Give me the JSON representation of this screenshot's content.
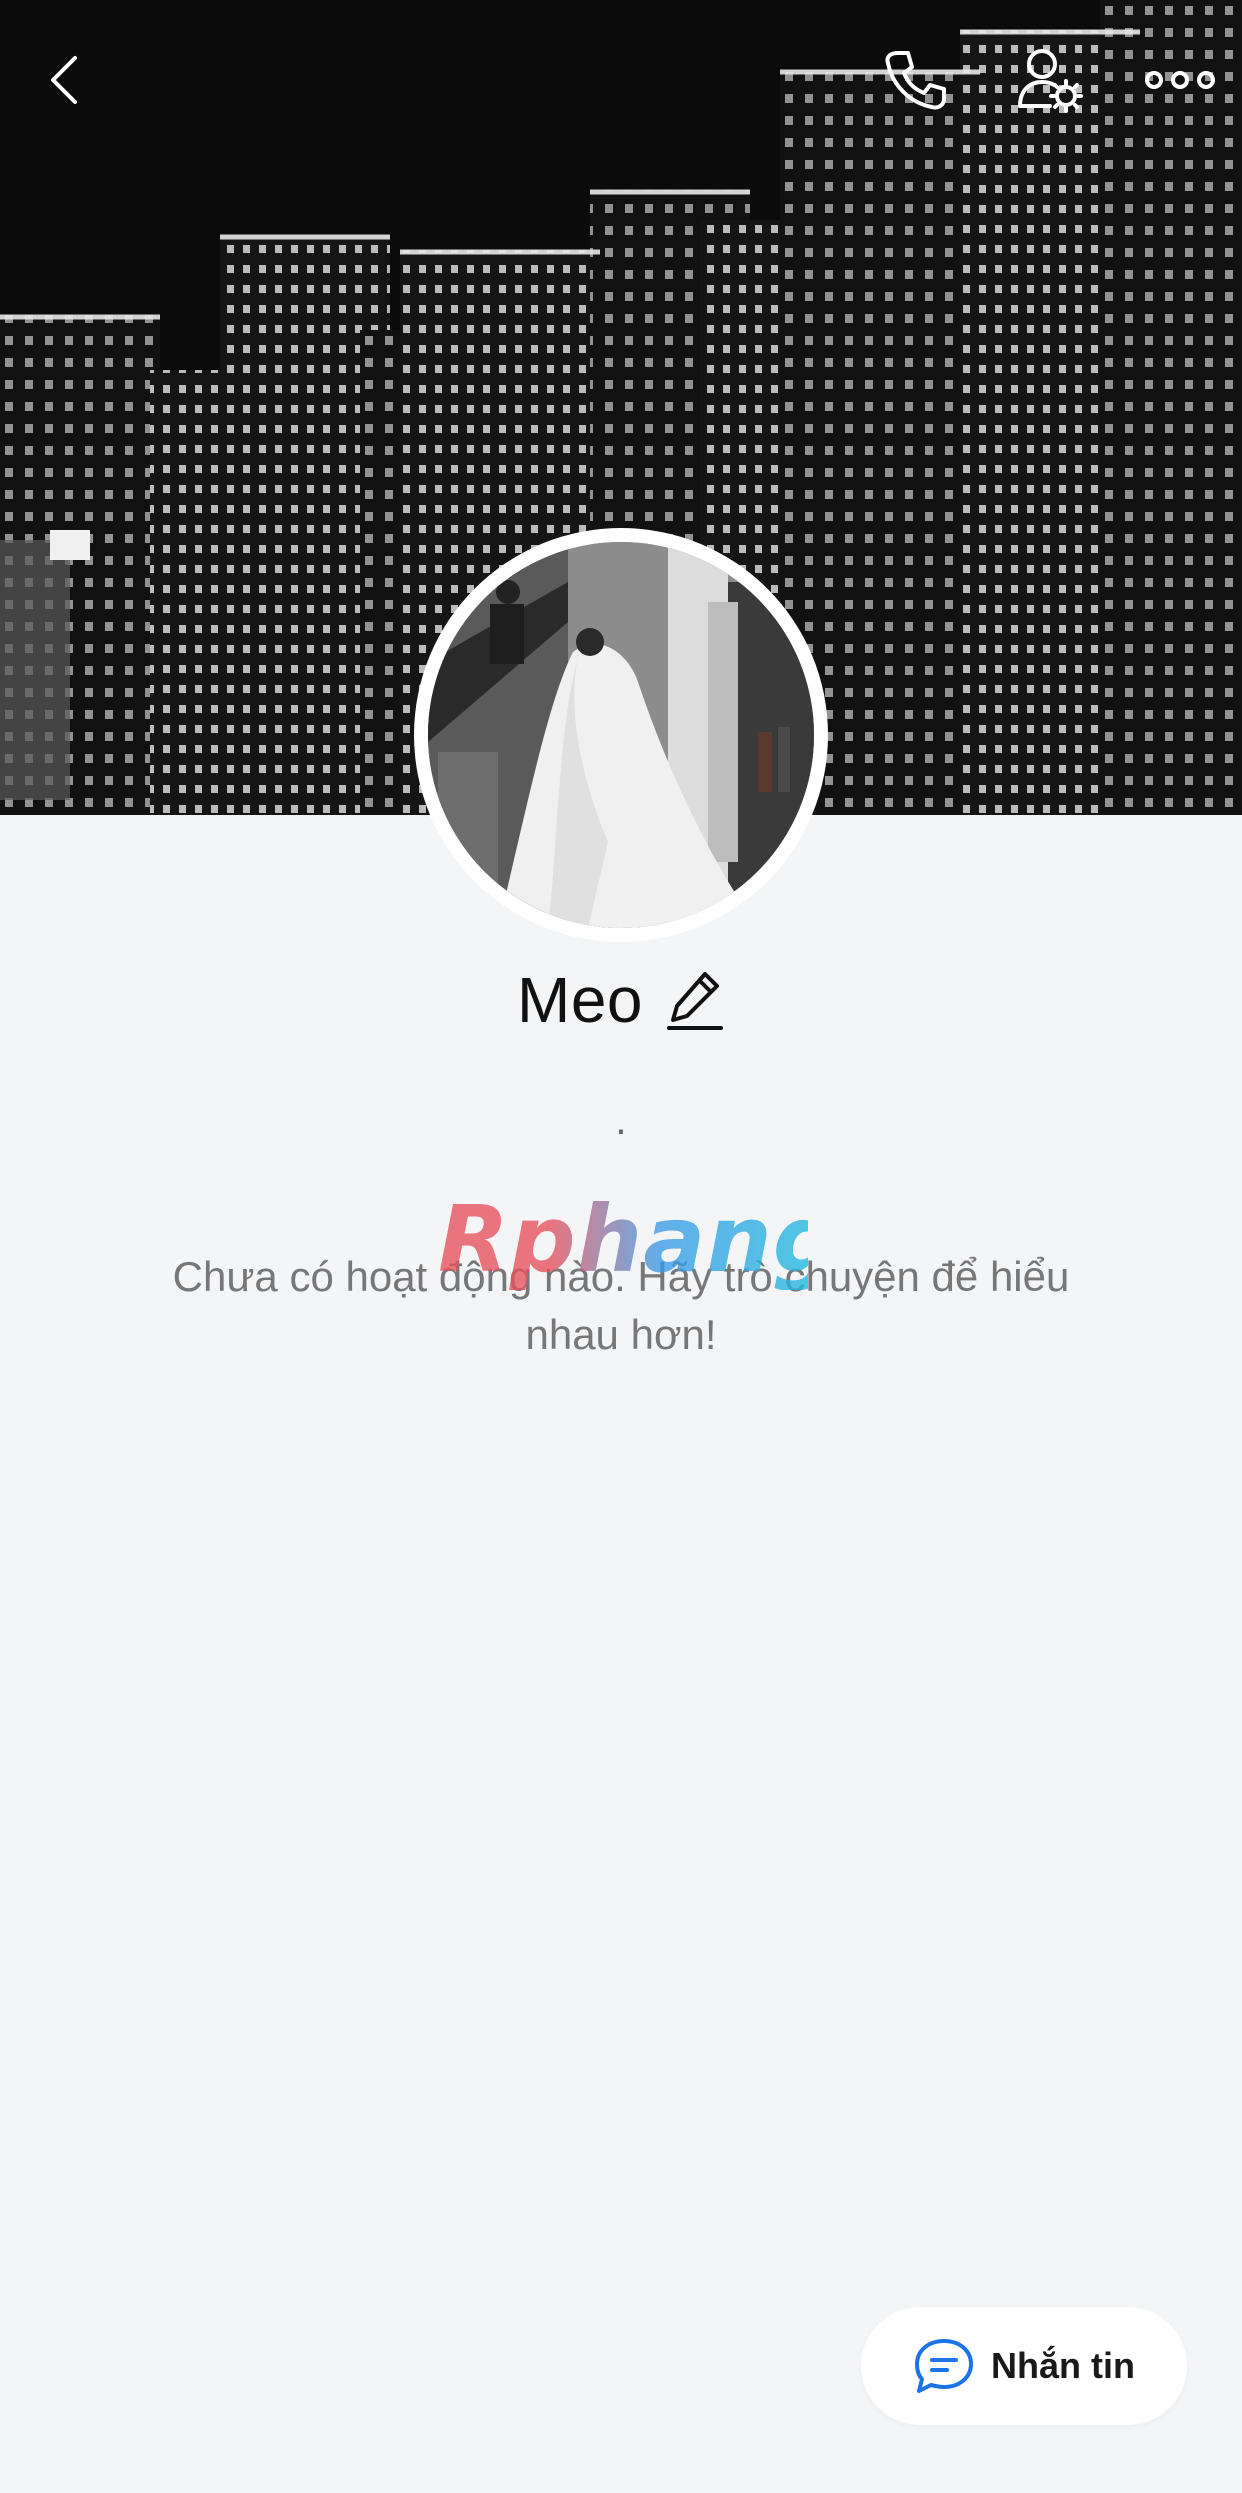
{
  "header": {
    "back_icon": "chevron-left-icon",
    "call_icon": "phone-icon",
    "settings_icon": "user-settings-icon",
    "more_icon": "more-dots-icon"
  },
  "profile": {
    "name": "Meo",
    "edit_icon": "pencil-icon",
    "bio": "."
  },
  "watermark": "Rphang",
  "feed": {
    "empty_message": "Chưa có hoạt động nào. Hãy trò chuyện để hiểu nhau hơn!"
  },
  "actions": {
    "message_label": "Nhắn tin",
    "message_icon": "chat-bubble-icon"
  },
  "colors": {
    "accent": "#1a73e8",
    "background": "#f4f5f7"
  }
}
